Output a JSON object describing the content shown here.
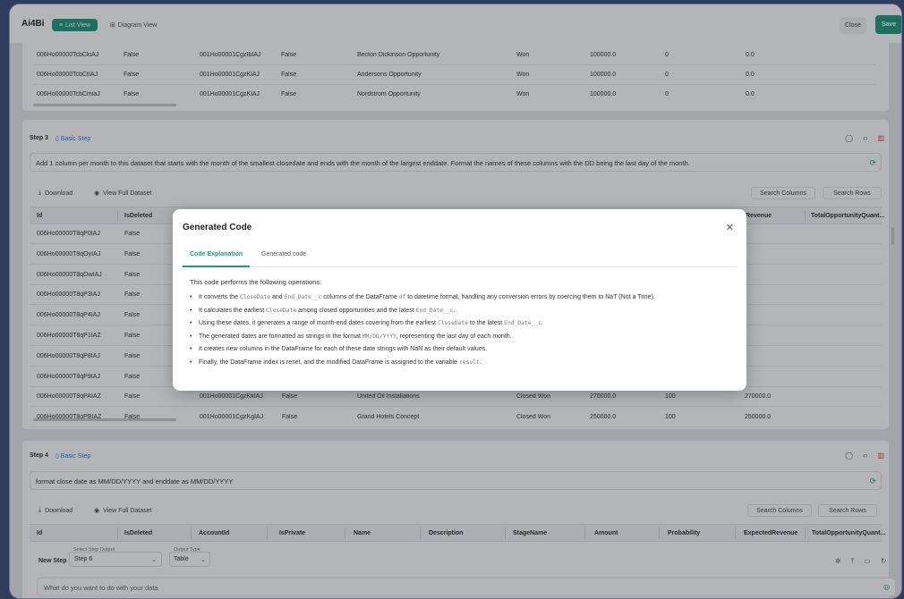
{
  "app": {
    "title": "Ai4Bi",
    "list_view": "List View",
    "diagram_view": "Diagram View",
    "close": "Close",
    "save": "Save"
  },
  "step2_table": {
    "rows": [
      [
        "006Ho00000TcbCkiAJ",
        "False",
        "001Ho00001CgzIbIAJ",
        "False",
        "Becton Dickinson Opportunity",
        "Won",
        "100000.0",
        "0",
        "0.0"
      ],
      [
        "006Ho00000TcbCtIAJ",
        "False",
        "001Ho00001CgzKlAJ",
        "False",
        "Andersons Opportunity",
        "Won",
        "100000.0",
        "0",
        "0.0"
      ],
      [
        "006Ho00000TcbCmiaJ",
        "False",
        "001Ho00001CgzKlAJ",
        "False",
        "Nordstrom Opportunity",
        "Won",
        "100000.0",
        "0",
        "0.0"
      ]
    ]
  },
  "step3": {
    "label": "Step 3",
    "type": "Basic Step",
    "prompt": "Add 1 column per month to this dataset that starts with the month of the smallest closedate and ends with the month of the largest enddate. Format the names of these columns with the DD being the last day of the month.",
    "download": "Download",
    "view_full": "View Full Dataset",
    "search_columns": "Search Columns",
    "search_rows": "Search Rows",
    "headers": [
      "Id",
      "IsDeleted",
      "Revenue",
      "TotalOpportunityQuant..."
    ],
    "ids": [
      "006Ho00000T8qP0IAJ",
      "006Ho00000T8qOyIAJ",
      "006Ho00000T8qOwIAJ",
      "006Ho00000T8qP3IAJ",
      "006Ho00000T8qP4IAJ",
      "006Ho00000T8qP1IAZ",
      "006Ho00000T8qP8IAJ",
      "006Ho00000T8qP9IAJ",
      "006Ho00000T8qPAIAZ",
      "006Ho00000T8qPBIAZ"
    ],
    "deleted": [
      "False",
      "False",
      "False",
      "False",
      "False",
      "False",
      "False",
      "False",
      "False",
      "False"
    ],
    "extra_rows": [
      [
        "001Ho00001CgzKkIAJ",
        "False",
        "United Oil Installations",
        "Closed Won",
        "270000.0",
        "100",
        "270000.0"
      ],
      [
        "001Ho00001CgzKgIAJ",
        "False",
        "Grand Hotels Concept",
        "Closed Won",
        "250000.0",
        "100",
        "250000.0"
      ]
    ]
  },
  "modal": {
    "title": "Generated Code",
    "tab_explanation": "Code Explanation",
    "tab_code": "Generated code",
    "intro": "This code performs the following operations:",
    "bullets": [
      {
        "a": "It converts the ",
        "c1": "CloseDate",
        "b": " and ",
        "c2": "End_Date__c",
        "d": " columns of the DataFrame ",
        "c3": "df",
        "e": " to datetime format, handling any conversion errors by coercing them to NaT (Not a Time)."
      },
      {
        "a": "It calculates the earliest ",
        "c1": "CloseDate",
        "b": " among closed opportunities and the latest ",
        "c2": "End_Date__c",
        "d": ".",
        "c3": "",
        "e": ""
      },
      {
        "a": "Using these dates, it generates a range of month-end dates covering from the earliest ",
        "c1": "CloseDate",
        "b": " to the latest ",
        "c2": "End_Date__c",
        "d": ".",
        "c3": "",
        "e": ""
      },
      {
        "a": "The generated dates are formatted as strings in the format ",
        "c1": "MM/DD/YYYY",
        "b": ", representing the last day of each month.",
        "c2": "",
        "d": "",
        "c3": "",
        "e": ""
      },
      {
        "a": "It creates new columns in the DataFrame for each of these date strings with NaN as their default values.",
        "c1": "",
        "b": "",
        "c2": "",
        "d": "",
        "c3": "",
        "e": ""
      },
      {
        "a": "Finally, the DataFrame index is reset, and the modified DataFrame is assigned to the variable ",
        "c1": "result",
        "b": ".",
        "c2": "",
        "d": "",
        "c3": "",
        "e": ""
      }
    ]
  },
  "step4": {
    "label": "Step 4",
    "type": "Basic Step",
    "prompt": "format close date as MM/DD/YYYY and enddate as MM/DD/YYYY",
    "download": "Download",
    "view_full": "View Full Dataset",
    "search_columns": "Search Columns",
    "search_rows": "Search Rows",
    "headers": [
      "Id",
      "IsDeleted",
      "AccountId",
      "IsPrivate",
      "Name",
      "Description",
      "StageName",
      "Amount",
      "Probability",
      "ExpectedRevenue",
      "TotalOpportunityQuant..."
    ]
  },
  "new_step": {
    "label": "New Step",
    "step_output_label": "Select Step Output",
    "step_output_value": "Step 6",
    "output_type_label": "Output Type",
    "output_type_value": "Table",
    "placeholder": "What do you want to do with your data"
  }
}
